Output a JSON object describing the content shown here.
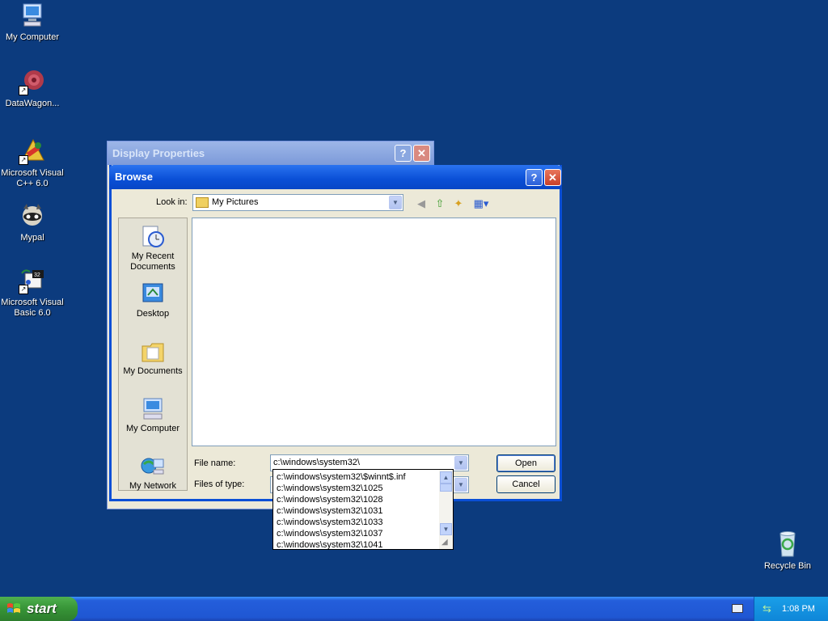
{
  "desktop": {
    "icons": [
      {
        "label": "My Computer"
      },
      {
        "label": "DataWagon..."
      },
      {
        "label": "Microsoft Visual C++ 6.0"
      },
      {
        "label": "Mypal"
      },
      {
        "label": "Microsoft Visual Basic 6.0"
      },
      {
        "label": "Recycle Bin"
      }
    ]
  },
  "background_window": {
    "title": "Display Properties",
    "help_label": "?",
    "close_label": "✕"
  },
  "browse_dialog": {
    "title": "Browse",
    "help_label": "?",
    "close_label": "✕",
    "look_in_label": "Look in:",
    "look_in_value": "My Pictures",
    "places": [
      {
        "label": "My Recent Documents"
      },
      {
        "label": "Desktop"
      },
      {
        "label": "My Documents"
      },
      {
        "label": "My Computer"
      },
      {
        "label": "My Network"
      }
    ],
    "file_name_label": "File name:",
    "file_name_value": "c:\\windows\\system32\\",
    "files_of_type_label": "Files of type:",
    "open_button": "Open",
    "cancel_button": "Cancel",
    "autocomplete_items": [
      "c:\\windows\\system32\\$winnt$.inf",
      "c:\\windows\\system32\\1025",
      "c:\\windows\\system32\\1028",
      "c:\\windows\\system32\\1031",
      "c:\\windows\\system32\\1033",
      "c:\\windows\\system32\\1037",
      "c:\\windows\\system32\\1041"
    ]
  },
  "taskbar": {
    "start_label": "start",
    "clock": "1:08 PM"
  },
  "colors": {
    "desktop_bg": "#0c3b7e",
    "title_active": "#0a4fd6",
    "dialog_face": "#ece9d8",
    "start_green": "#379437"
  }
}
